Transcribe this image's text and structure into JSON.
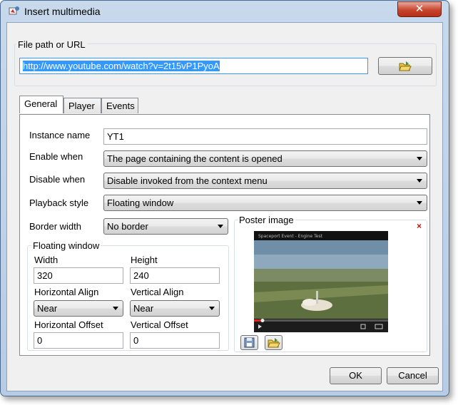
{
  "window": {
    "title": "Insert multimedia",
    "close_glyph": "✕"
  },
  "file_path": {
    "group_label": "File path or URL",
    "value": "http://www.youtube.com/watch?v=2t15vP1PyoA",
    "browse_icon": "folder-open-icon"
  },
  "tabs": [
    {
      "label": "General",
      "active": true
    },
    {
      "label": "Player",
      "active": false
    },
    {
      "label": "Events",
      "active": false
    }
  ],
  "general": {
    "instance_name": {
      "label": "Instance name",
      "value": "YT1"
    },
    "enable_when": {
      "label": "Enable when",
      "value": "The page containing the content is opened"
    },
    "disable_when": {
      "label": "Disable when",
      "value": "Disable invoked from the context menu"
    },
    "playback_style": {
      "label": "Playback style",
      "value": "Floating window"
    },
    "border_width": {
      "label": "Border width",
      "value": "No border"
    }
  },
  "floating_window": {
    "group_label": "Floating window",
    "width": {
      "label": "Width",
      "value": "320"
    },
    "height": {
      "label": "Height",
      "value": "240"
    },
    "horizontal_align": {
      "label": "Horizontal Align",
      "value": "Near"
    },
    "vertical_align": {
      "label": "Vertical Align",
      "value": "Near"
    },
    "horizontal_offset": {
      "label": "Horizontal Offset",
      "value": "0"
    },
    "vertical_offset": {
      "label": "Vertical Offset",
      "value": "0"
    }
  },
  "poster": {
    "group_label": "Poster image",
    "remove_glyph": "×",
    "video_title": "Spaceport Event - Engine Test"
  },
  "footer": {
    "ok_label": "OK",
    "cancel_label": "Cancel"
  },
  "colors": {
    "selection": "#3399ff",
    "window_frame": "#b7cbe4",
    "close_button": "#c7462c"
  }
}
